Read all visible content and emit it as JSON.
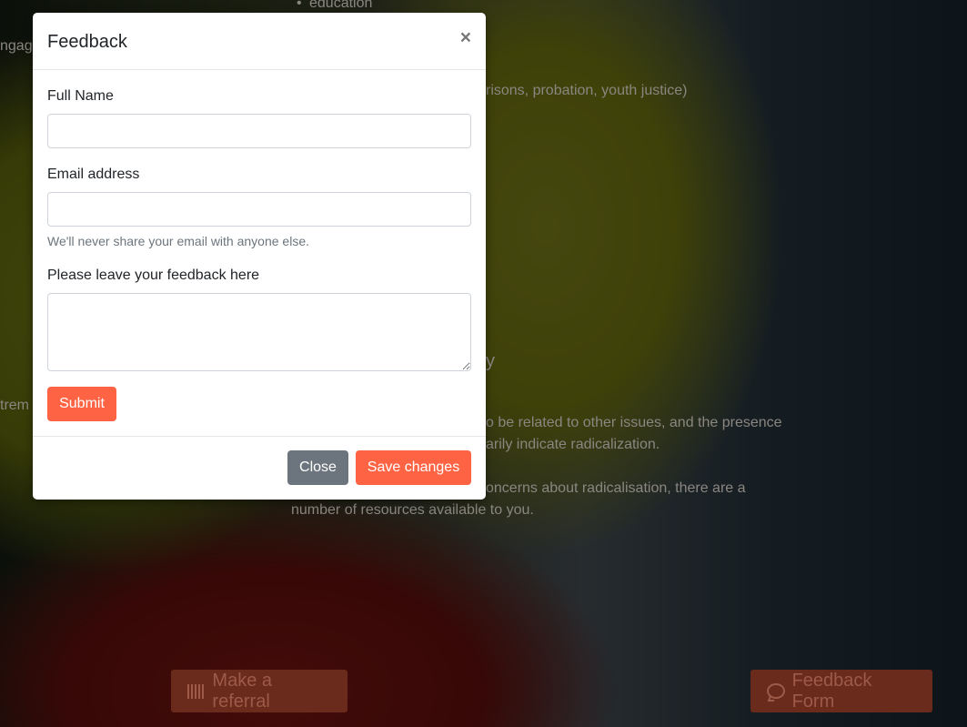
{
  "background": {
    "bullet_text": "education",
    "left_fragment_1": "ngag",
    "right_fragment_1": "risons, probation, youth justice)",
    "heading_fragment": "y",
    "left_fragment_2": "trem",
    "paragraph_line_1": "o be related to other issues, and the presence",
    "paragraph_line_2": "arily indicate radicalization.",
    "paragraph_line_3": "oncerns about radicalisation, there are a",
    "paragraph_line_4": "number of resources available to you.",
    "referral_button_label": "Make a referral",
    "feedback_button_label": "Feedback Form",
    "referral_icon": "barcode-icon",
    "feedback_icon": "comment-icon"
  },
  "modal": {
    "title": "Feedback",
    "close_symbol": "×",
    "fields": {
      "full_name_label": "Full Name",
      "full_name_value": "",
      "email_label": "Email address",
      "email_value": "",
      "email_help": "We'll never share your email with anyone else.",
      "feedback_label": "Please leave your feedback here",
      "feedback_value": ""
    },
    "submit_label": "Submit",
    "footer": {
      "close_label": "Close",
      "save_label": "Save changes"
    }
  },
  "colors": {
    "accent": "#fe6344",
    "secondary": "#6c757d"
  }
}
